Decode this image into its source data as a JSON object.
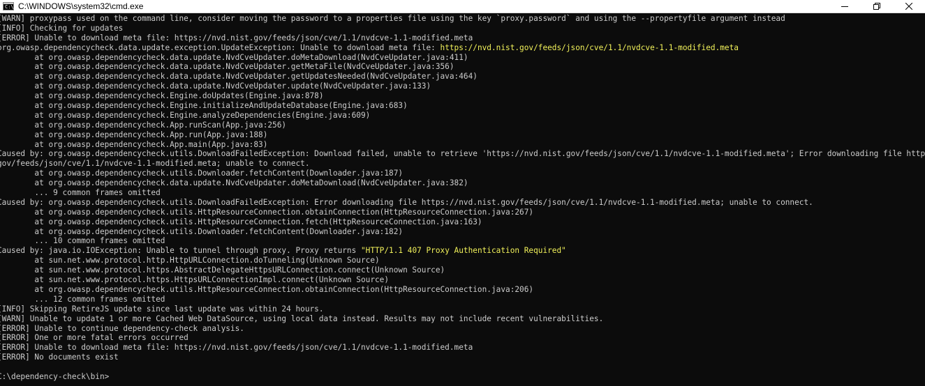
{
  "window": {
    "title": "C:\\WINDOWS\\system32\\cmd.exe",
    "icon": "cmd-icon",
    "controls": {
      "minimize": "minimize-icon",
      "maximize": "maximize-icon",
      "close": "close-icon"
    }
  },
  "colors": {
    "background": "#0c0c0c",
    "text": "#cccccc",
    "highlight": "#f1f15a"
  },
  "lines": [
    {
      "segments": [
        {
          "text": "[WARN] proxypass used on the command line, consider moving the password to a properties file using the key `proxy.password` and using the --propertyfile argument instead"
        }
      ]
    },
    {
      "segments": [
        {
          "text": "[INFO] Checking for updates"
        }
      ]
    },
    {
      "segments": [
        {
          "text": "[ERROR] Unable to download meta file: https://nvd.nist.gov/feeds/json/cve/1.1/nvdcve-1.1-modified.meta"
        }
      ]
    },
    {
      "segments": [
        {
          "text": "org.owasp.dependencycheck.data.update.exception.UpdateException: Unable to download meta file: "
        },
        {
          "text": "https://nvd.nist.gov/feeds/json/cve/1.1/nvdcve-1.1-modified.meta",
          "highlight": true
        }
      ]
    },
    {
      "segments": [
        {
          "text": "        at org.owasp.dependencycheck.data.update.NvdCveUpdater.doMetaDownload(NvdCveUpdater.java:411)"
        }
      ]
    },
    {
      "segments": [
        {
          "text": "        at org.owasp.dependencycheck.data.update.NvdCveUpdater.getMetaFile(NvdCveUpdater.java:356)"
        }
      ]
    },
    {
      "segments": [
        {
          "text": "        at org.owasp.dependencycheck.data.update.NvdCveUpdater.getUpdatesNeeded(NvdCveUpdater.java:464)"
        }
      ]
    },
    {
      "segments": [
        {
          "text": "        at org.owasp.dependencycheck.data.update.NvdCveUpdater.update(NvdCveUpdater.java:133)"
        }
      ]
    },
    {
      "segments": [
        {
          "text": "        at org.owasp.dependencycheck.Engine.doUpdates(Engine.java:878)"
        }
      ]
    },
    {
      "segments": [
        {
          "text": "        at org.owasp.dependencycheck.Engine.initializeAndUpdateDatabase(Engine.java:683)"
        }
      ]
    },
    {
      "segments": [
        {
          "text": "        at org.owasp.dependencycheck.Engine.analyzeDependencies(Engine.java:609)"
        }
      ]
    },
    {
      "segments": [
        {
          "text": "        at org.owasp.dependencycheck.App.runScan(App.java:256)"
        }
      ]
    },
    {
      "segments": [
        {
          "text": "        at org.owasp.dependencycheck.App.run(App.java:188)"
        }
      ]
    },
    {
      "segments": [
        {
          "text": "        at org.owasp.dependencycheck.App.main(App.java:83)"
        }
      ]
    },
    {
      "segments": [
        {
          "text": "Caused by: org.owasp.dependencycheck.utils.DownloadFailedException: Download failed, unable to retrieve 'https://nvd.nist.gov/feeds/json/cve/1.1/nvdcve-1.1-modified.meta'; Error downloading file https://nvd.nist."
        }
      ]
    },
    {
      "segments": [
        {
          "text": "gov/feeds/json/cve/1.1/nvdcve-1.1-modified.meta; unable to connect."
        }
      ]
    },
    {
      "segments": [
        {
          "text": "        at org.owasp.dependencycheck.utils.Downloader.fetchContent(Downloader.java:187)"
        }
      ]
    },
    {
      "segments": [
        {
          "text": "        at org.owasp.dependencycheck.data.update.NvdCveUpdater.doMetaDownload(NvdCveUpdater.java:382)"
        }
      ]
    },
    {
      "segments": [
        {
          "text": "        ... 9 common frames omitted"
        }
      ]
    },
    {
      "segments": [
        {
          "text": "Caused by: org.owasp.dependencycheck.utils.DownloadFailedException: Error downloading file https://nvd.nist.gov/feeds/json/cve/1.1/nvdcve-1.1-modified.meta; unable to connect."
        }
      ]
    },
    {
      "segments": [
        {
          "text": "        at org.owasp.dependencycheck.utils.HttpResourceConnection.obtainConnection(HttpResourceConnection.java:267)"
        }
      ]
    },
    {
      "segments": [
        {
          "text": "        at org.owasp.dependencycheck.utils.HttpResourceConnection.fetch(HttpResourceConnection.java:163)"
        }
      ]
    },
    {
      "segments": [
        {
          "text": "        at org.owasp.dependencycheck.utils.Downloader.fetchContent(Downloader.java:182)"
        }
      ]
    },
    {
      "segments": [
        {
          "text": "        ... 10 common frames omitted"
        }
      ]
    },
    {
      "segments": [
        {
          "text": "Caused by: java.io.IOException: Unable to tunnel through proxy. Proxy returns "
        },
        {
          "text": "\"HTTP/1.1 407 Proxy Authentication Required\"",
          "highlight": true
        }
      ]
    },
    {
      "segments": [
        {
          "text": "        at sun.net.www.protocol.http.HttpURLConnection.doTunneling(Unknown Source)"
        }
      ]
    },
    {
      "segments": [
        {
          "text": "        at sun.net.www.protocol.https.AbstractDelegateHttpsURLConnection.connect(Unknown Source)"
        }
      ]
    },
    {
      "segments": [
        {
          "text": "        at sun.net.www.protocol.https.HttpsURLConnectionImpl.connect(Unknown Source)"
        }
      ]
    },
    {
      "segments": [
        {
          "text": "        at org.owasp.dependencycheck.utils.HttpResourceConnection.obtainConnection(HttpResourceConnection.java:206)"
        }
      ]
    },
    {
      "segments": [
        {
          "text": "        ... 12 common frames omitted"
        }
      ]
    },
    {
      "segments": [
        {
          "text": "[INFO] Skipping RetireJS update since last update was within 24 hours."
        }
      ]
    },
    {
      "segments": [
        {
          "text": "[WARN] Unable to update 1 or more Cached Web DataSource, using local data instead. Results may not include recent vulnerabilities."
        }
      ]
    },
    {
      "segments": [
        {
          "text": "[ERROR] Unable to continue dependency-check analysis."
        }
      ]
    },
    {
      "segments": [
        {
          "text": "[ERROR] One or more fatal errors occurred"
        }
      ]
    },
    {
      "segments": [
        {
          "text": "[ERROR] Unable to download meta file: https://nvd.nist.gov/feeds/json/cve/1.1/nvdcve-1.1-modified.meta"
        }
      ]
    },
    {
      "segments": [
        {
          "text": "[ERROR] No documents exist"
        }
      ]
    },
    {
      "segments": [
        {
          "text": ""
        }
      ]
    },
    {
      "segments": [
        {
          "text": "C:\\dependency-check\\bin>"
        }
      ]
    }
  ]
}
